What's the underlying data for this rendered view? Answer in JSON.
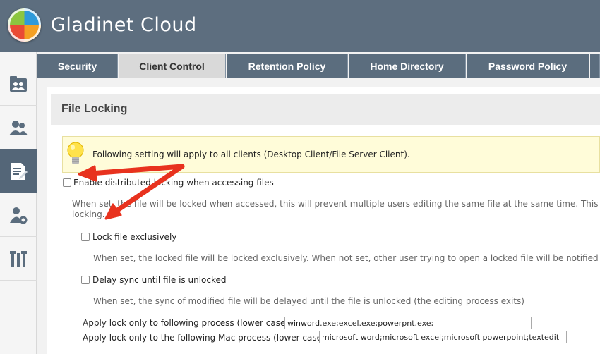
{
  "app": {
    "title": "Gladinet Cloud"
  },
  "sidebar": {
    "items": [
      {
        "icon": "folder-users-icon"
      },
      {
        "icon": "users-icon"
      },
      {
        "icon": "document-edit-icon",
        "active": true
      },
      {
        "icon": "user-settings-icon"
      },
      {
        "icon": "tools-icon"
      }
    ]
  },
  "tabs": [
    {
      "label": "Security"
    },
    {
      "label": "Client Control",
      "active": true
    },
    {
      "label": "Retention Policy"
    },
    {
      "label": "Home Directory"
    },
    {
      "label": "Password Policy"
    }
  ],
  "section": {
    "title": "File Locking"
  },
  "notice": {
    "text": "Following setting will apply to all clients (Desktop Client/File Server Client)."
  },
  "options": {
    "distributed": {
      "label": "Enable distributed locking when accessing files",
      "checked": false,
      "desc_line1": "When set, the file will be locked when accessed, this will prevent multiple users editing the same file at the same time. This may",
      "desc_line2": "locking."
    },
    "exclusive": {
      "label": "Lock file exclusively",
      "checked": false,
      "desc": "When set, the locked file will be locked exclusively. When not set, other user trying to open a locked file will be notified abo"
    },
    "delay_sync": {
      "label": "Delay sync until file is unlocked",
      "checked": false,
      "desc": "When set, the sync of modified file will be delayed until the file is unlocked (the editing process exits)"
    }
  },
  "process_fields": {
    "windows_label": "Apply lock only to following process (lower case):",
    "windows_value": "winword.exe;excel.exe;powerpnt.exe;",
    "mac_label": "Apply lock only to the following Mac process (lower case):",
    "mac_value": "microsoft word;microsoft excel;microsoft powerpoint;textedit"
  },
  "annotation": {
    "arrow_color": "#e8321e"
  }
}
